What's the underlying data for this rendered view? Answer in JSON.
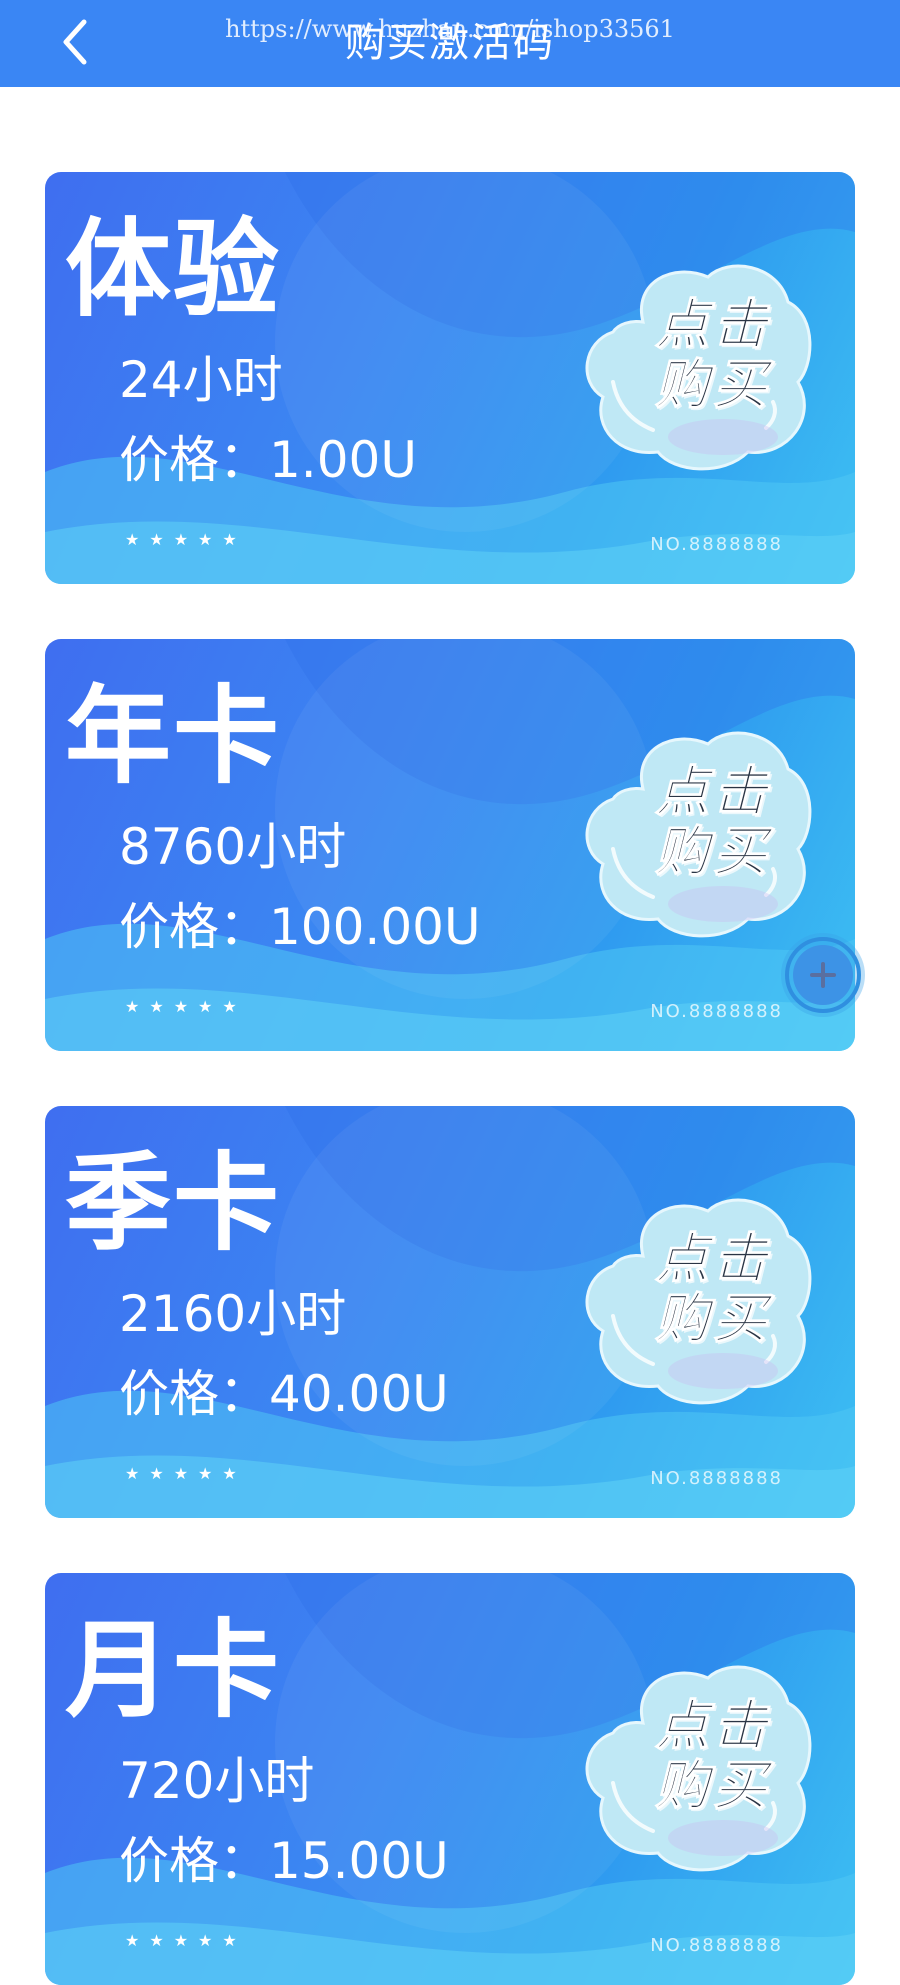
{
  "header": {
    "title": "购买激活码",
    "watermark": "https://www.huzhan.com/ishop33561",
    "back_icon": "chevron-left-icon"
  },
  "cards": [
    {
      "name": "体验",
      "hours": "24小时",
      "price": "价格：1.00U",
      "stars": "★★★★★",
      "number": "NO.8888888",
      "buy_line1": "点击",
      "buy_line2": "购买"
    },
    {
      "name": "年卡",
      "hours": "8760小时",
      "price": "价格：100.00U",
      "stars": "★★★★★",
      "number": "NO.8888888",
      "buy_line1": "点击",
      "buy_line2": "购买"
    },
    {
      "name": "季卡",
      "hours": "2160小时",
      "price": "价格：40.00U",
      "stars": "★★★★★",
      "number": "NO.8888888",
      "buy_line1": "点击",
      "buy_line2": "购买"
    },
    {
      "name": "月卡",
      "hours": "720小时",
      "price": "价格：15.00U",
      "stars": "★★★★★",
      "number": "NO.8888888",
      "buy_line1": "点击",
      "buy_line2": "购买"
    }
  ],
  "floating_button": {
    "icon": "plus-icon"
  },
  "colors": {
    "header": "#3a86f4",
    "card_start": "#3f6ef0",
    "card_end": "#3dc0f2",
    "bubble": "#bfe8f5",
    "float_button": "#2f8fe0"
  }
}
